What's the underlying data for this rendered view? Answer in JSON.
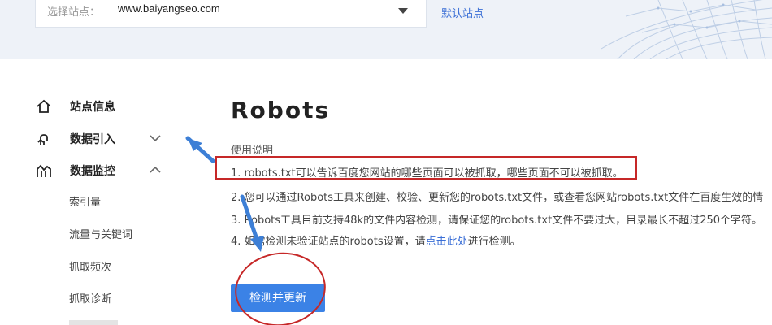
{
  "header": {
    "site_label": "选择站点：",
    "site_value": "www.baiyangseo.com",
    "default_site_link": "默认站点"
  },
  "sidebar": {
    "items": [
      {
        "label": "站点信息",
        "icon": "home-icon"
      },
      {
        "label": "数据引入",
        "icon": "data-import-icon",
        "expanded": false
      },
      {
        "label": "数据监控",
        "icon": "chart-icon",
        "expanded": true
      }
    ],
    "sub_items": [
      "索引量",
      "流量与关键词",
      "抓取频次",
      "抓取诊断"
    ]
  },
  "main": {
    "title": "Robots",
    "section_title": "使用说明",
    "instructions": [
      "1. robots.txt可以告诉百度您网站的哪些页面可以被抓取，哪些页面不可以被抓取。",
      "2. 您可以通过Robots工具来创建、校验、更新您的robots.txt文件，或查看您网站robots.txt文件在百度生效的情",
      "3. Robots工具目前支持48k的文件内容检测，请保证您的robots.txt文件不要过大，目录最长不超过250个字符。",
      "4. 如需检测未验证站点的robots设置，请",
      "点击此处",
      "进行检测。"
    ],
    "check_button": "检测并更新"
  },
  "colors": {
    "accent_blue": "#3b82e6",
    "link_blue": "#3b6fd6",
    "annotation_red": "#c62828",
    "annotation_arrow": "#3d7fd6"
  }
}
